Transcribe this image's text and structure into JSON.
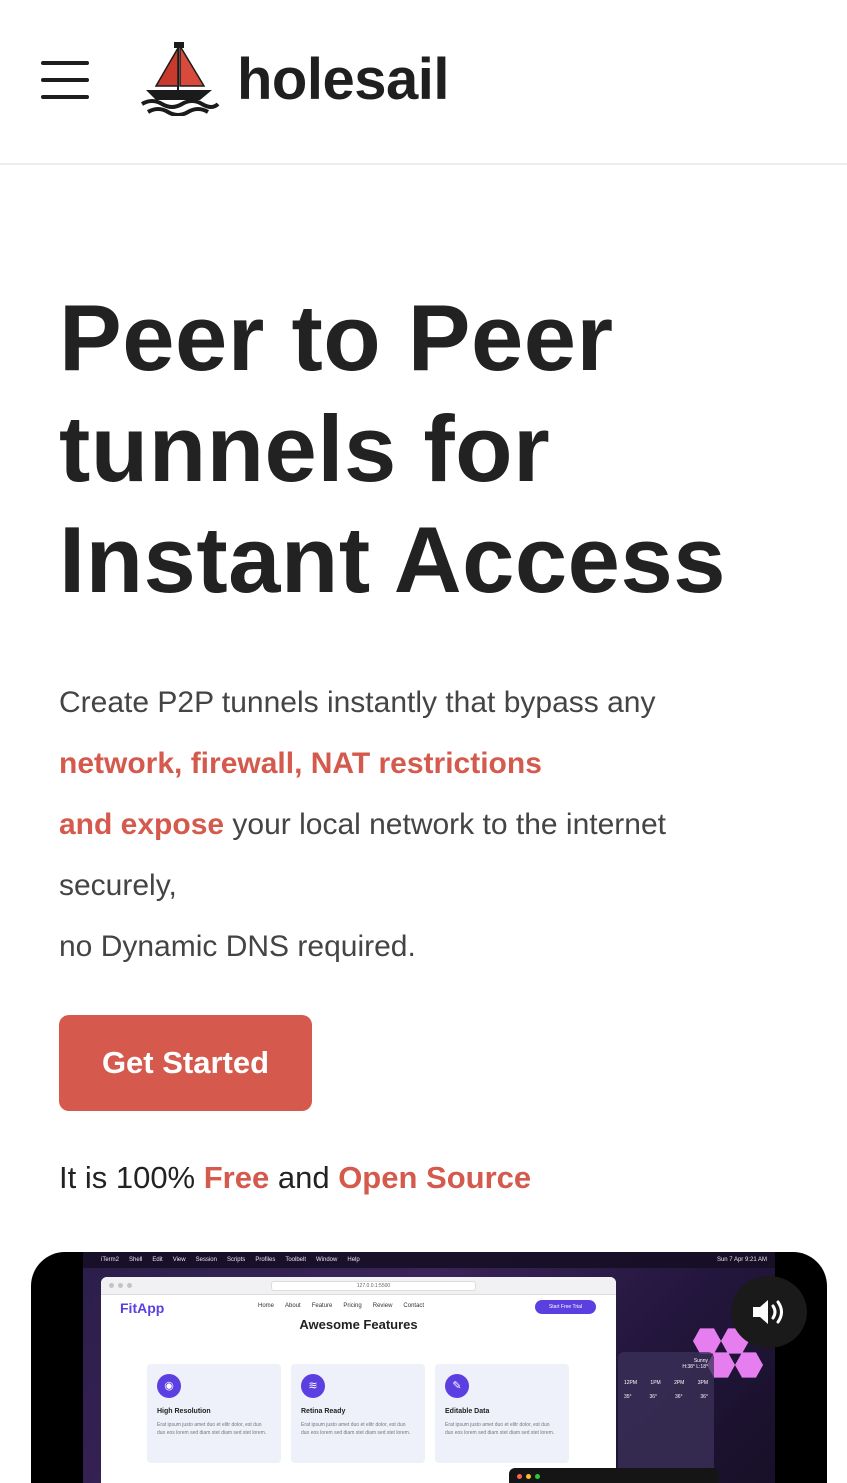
{
  "header": {
    "brand": "holesail",
    "menu_icon": "hamburger-menu-icon",
    "logo_icon": "sailboat-logo-icon"
  },
  "hero": {
    "title_lines": [
      "Peer to Peer",
      "tunnels for",
      "Instant Access"
    ],
    "desc": {
      "line1": "Create P2P tunnels instantly that bypass any",
      "line2_accent": "network, firewall, NAT restrictions",
      "line3_accent": "and expose",
      "line3_rest": " your local network to the internet",
      "line4": "securely,",
      "line5": "no Dynamic DNS required."
    },
    "cta_label": "Get Started",
    "free": {
      "prefix": "It is 100% ",
      "free": "Free",
      "middle": " and ",
      "open_source": "Open Source"
    }
  },
  "video": {
    "menubar_items": [
      "iTerm2",
      "Shell",
      "Edit",
      "View",
      "Session",
      "Scripts",
      "Profiles",
      "Toolbelt",
      "Window",
      "Help"
    ],
    "menubar_right": "Sun 7 Apr 9:21 AM",
    "url": "127.0.0.1:5500",
    "site": {
      "logo": "FitApp",
      "links": [
        "Home",
        "About",
        "Feature",
        "Pricing",
        "Review",
        "Contact"
      ],
      "cta": "Start Free Trial",
      "section_title": "Awesome Features",
      "cards": [
        {
          "title": "High Resolution",
          "text": "Erat ipsum justo amet duo et elitr dolor, est duo duo eos lorem sed diam stet diam sed stet lorem."
        },
        {
          "title": "Retina Ready",
          "text": "Erat ipsum justo amet duo et elitr dolor, est duo duo eos lorem sed diam stet diam sed stet lorem."
        },
        {
          "title": "Editable Data",
          "text": "Erat ipsum justo amet duo et elitr dolor, est duo duo eos lorem sed diam stet diam sed stet lorem."
        }
      ]
    },
    "weather": {
      "condition": "Sunny",
      "range": "H:38° L:18°",
      "hours": [
        "12PM",
        "1PM",
        "2PM",
        "3PM"
      ],
      "temps": [
        "35°",
        "36°",
        "36°",
        "36°"
      ]
    },
    "volume_icon": "speaker-volume-icon"
  },
  "colors": {
    "accent": "#d6594d",
    "text_dark": "#222222",
    "text_body": "#444444"
  }
}
